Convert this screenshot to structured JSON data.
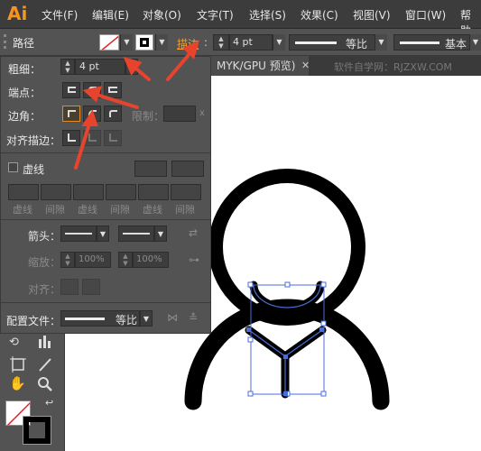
{
  "app": {
    "logo": "Ai"
  },
  "menu": [
    "文件(F)",
    "编辑(E)",
    "对象(O)",
    "文字(T)",
    "选择(S)",
    "效果(C)",
    "视图(V)",
    "窗口(W)",
    "帮助"
  ],
  "control_bar": {
    "mode_label": "路径",
    "stroke_link": "描边",
    "stroke_weight": "4 pt",
    "profile_label": "等比",
    "brush_label": "基本"
  },
  "doc_tabs": {
    "tab_label": "MYK/GPU 预览)",
    "watermark": "软件自学网：RJZXW.COM"
  },
  "stroke_panel": {
    "weight_label": "粗细：",
    "weight_value": "4 pt",
    "cap_label": "端点：",
    "corner_label": "边角：",
    "limit_label": "限制：",
    "limit_unit": "x",
    "align_label": "对齐描边：",
    "dashed_label": "虚线",
    "dash_labels": [
      "虚线",
      "间隙",
      "虚线",
      "间隙",
      "虚线",
      "间隙"
    ],
    "arrow_label": "箭头：",
    "scale_label": "缩放：",
    "scale_start": "100%",
    "scale_end": "100%",
    "align2_label": "对齐：",
    "profile_label": "配置文件：",
    "profile_value": "等比"
  },
  "colors": {
    "accent": "#e08a2a",
    "annotation_red": "#e8432c",
    "selection": "#4a6ed8"
  }
}
